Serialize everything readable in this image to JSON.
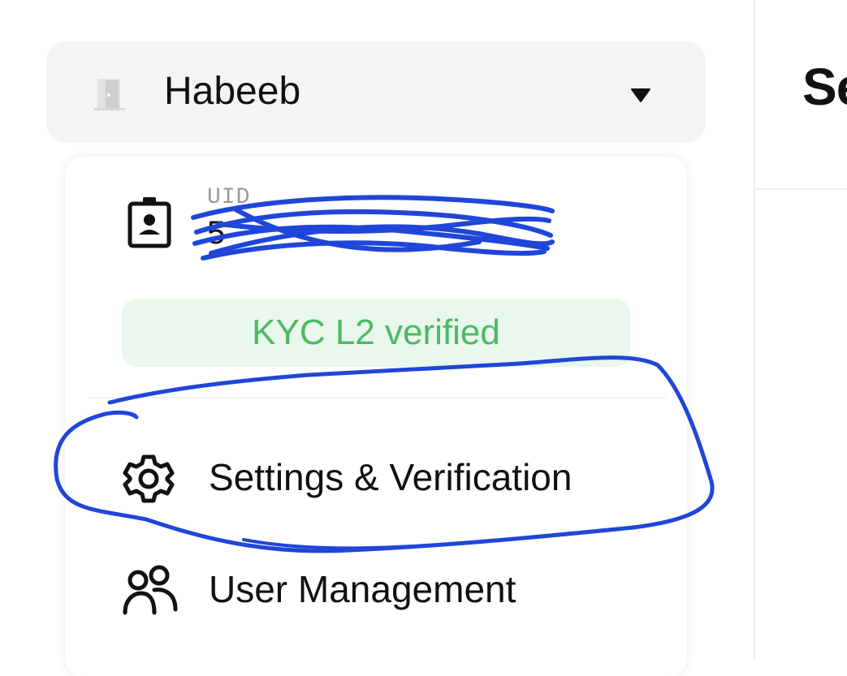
{
  "account": {
    "name": "Habeeb",
    "door_icon": "door-icon",
    "caret_icon": "caret-down-icon"
  },
  "page": {
    "title": "Se"
  },
  "dropdown": {
    "uid_label": "UID",
    "uid_value": "5",
    "kyc_status": "KYC L2 verified",
    "kyc_color": "#4cba63",
    "kyc_bg": "#e9f7ec",
    "items": [
      {
        "label": "Settings & Verification",
        "icon": "gear-icon"
      },
      {
        "label": "User Management",
        "icon": "users-icon"
      }
    ]
  },
  "annotation": {
    "color": "#1f46d8"
  }
}
